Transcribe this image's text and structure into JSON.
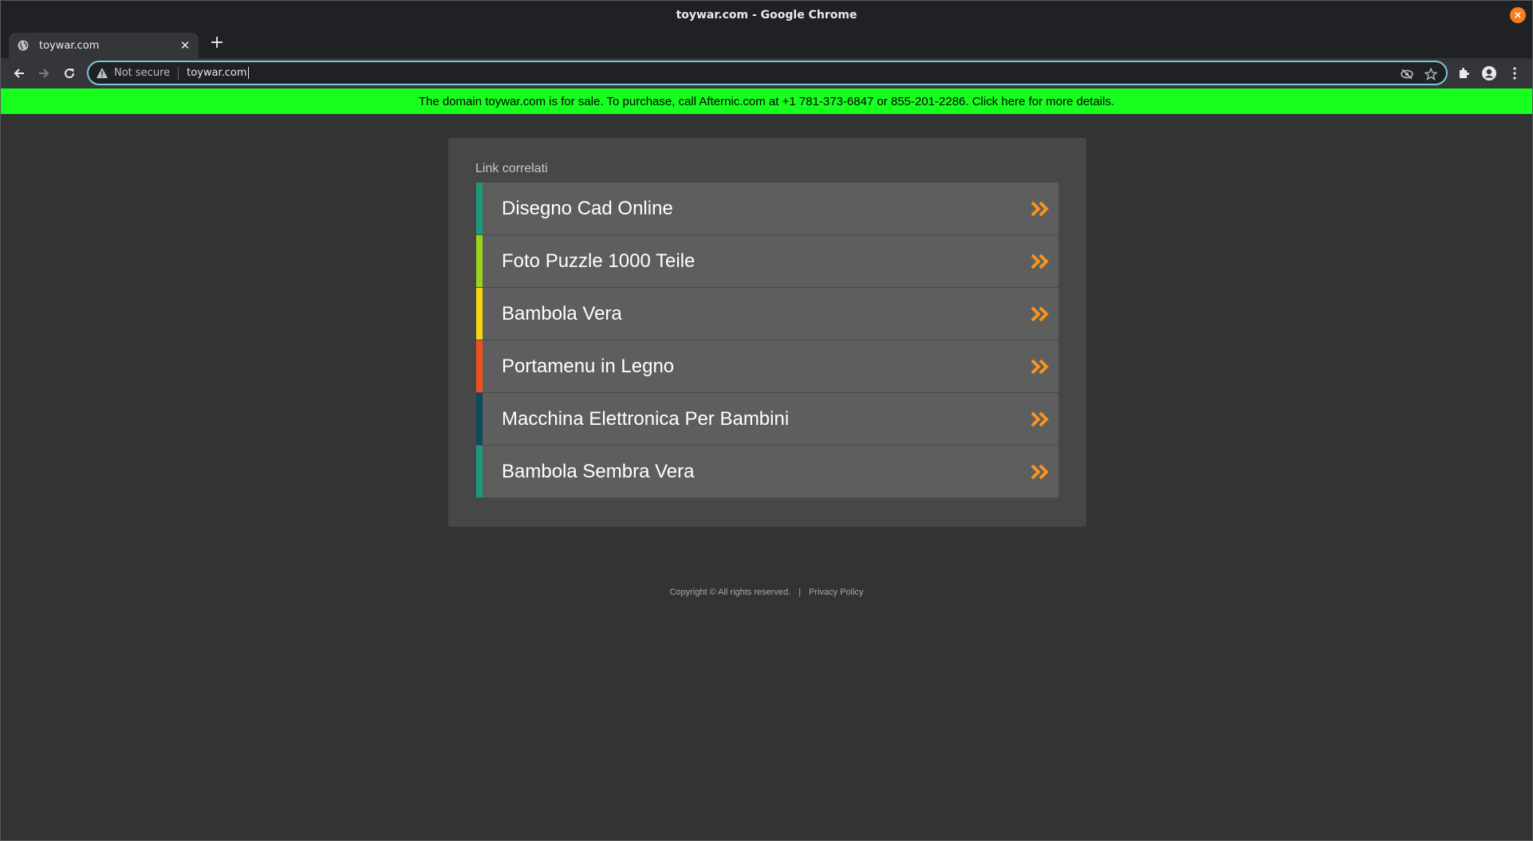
{
  "window": {
    "title": "toywar.com - Google Chrome",
    "close_label": "×"
  },
  "tabs": [
    {
      "title": "toywar.com",
      "favicon": "globe-icon"
    }
  ],
  "new_tab_label": "+",
  "toolbar": {
    "security_text": "Not secure",
    "url": "toywar.com"
  },
  "banner": {
    "text": "The domain toywar.com is for sale. To purchase, call Afternic.com at +1 781-373-6847 or 855-201-2286. Click here for more details.",
    "color": "#17ff1f"
  },
  "related": {
    "title": "Link correlati",
    "items": [
      {
        "label": "Disegno Cad Online",
        "color": "#1a9a7a"
      },
      {
        "label": "Foto Puzzle 1000 Teile",
        "color": "#9ad31c"
      },
      {
        "label": "Bambola Vera",
        "color": "#f2d40f"
      },
      {
        "label": "Portamenu in Legno",
        "color": "#f0511a"
      },
      {
        "label": "Macchina Elettronica Per Bambini",
        "color": "#0f4a5c"
      },
      {
        "label": "Bambola Sembra Vera",
        "color": "#1a9a7a"
      }
    ],
    "arrow_color": "#f7931e"
  },
  "footer": {
    "copyright": "Copyright ©  All rights reserved.",
    "separator": "|",
    "privacy": "Privacy Policy"
  }
}
